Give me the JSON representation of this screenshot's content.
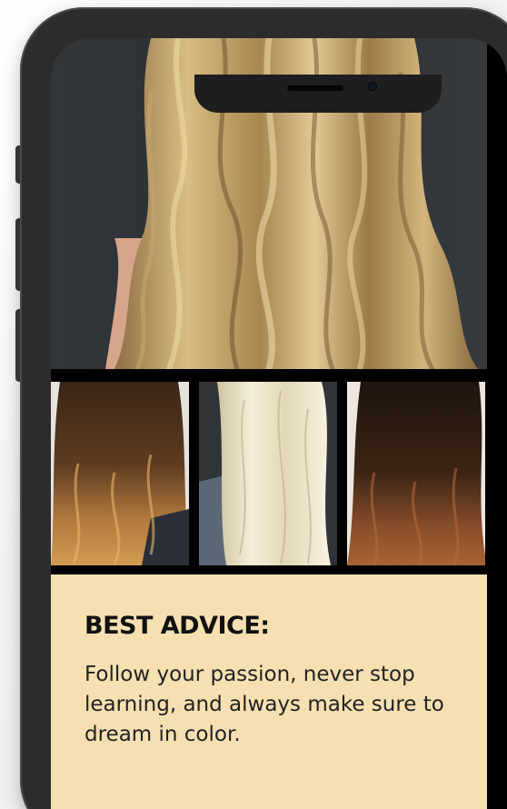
{
  "advice": {
    "title": "BEST ADVICE:",
    "body": "Follow your passion, never stop learning, and always make sure to dream in color."
  },
  "gallery": {
    "hero": {
      "icon": "hair-photo"
    },
    "thumbnails": [
      {
        "icon": "hair-photo"
      },
      {
        "icon": "hair-photo"
      },
      {
        "icon": "hair-photo"
      }
    ]
  },
  "colors": {
    "advice_background": "#f6e0b2",
    "phone_frame": "#2c2c2c"
  }
}
